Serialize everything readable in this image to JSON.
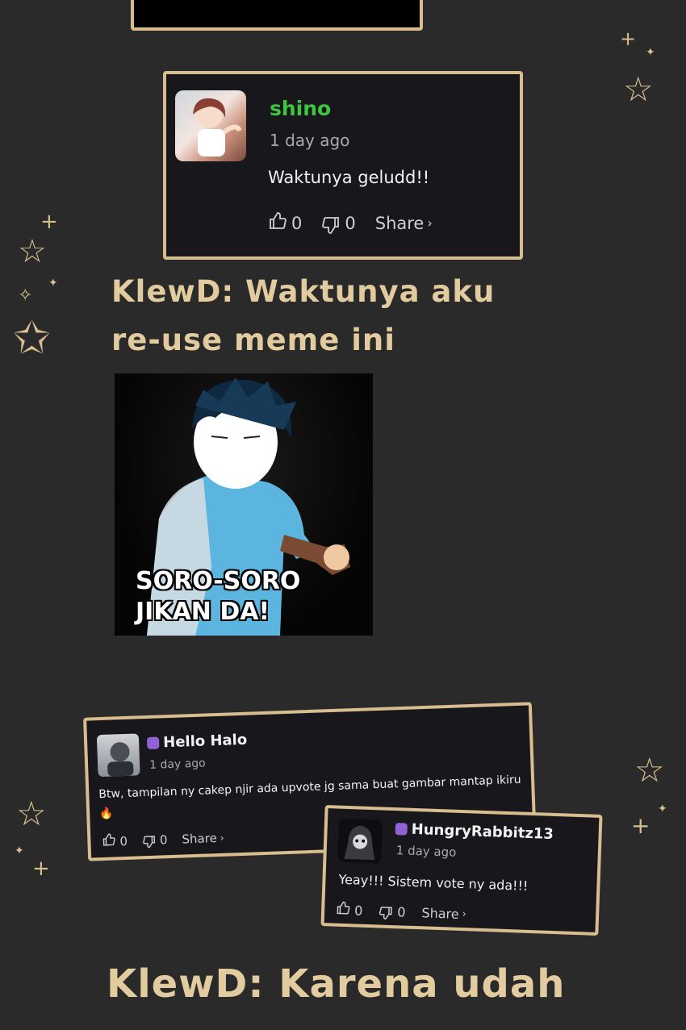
{
  "main_comment": {
    "username": "shino",
    "time": "1 day ago",
    "text": "Waktunya geludd!!",
    "upvotes": "0",
    "downvotes": "0",
    "share_label": "Share"
  },
  "caption_1": {
    "line1": "KlewD: Waktunya aku",
    "line2": "re-use meme ini"
  },
  "meme": {
    "line1": "SORO-SORO",
    "line2": "JIKAN DA!"
  },
  "comment_2": {
    "username": "Hello Halo",
    "time": "1 day ago",
    "text": "Btw, tampilan ny cakep njir ada upvote jg sama buat gambar mantap ikiru",
    "emoji": "🔥",
    "upvotes": "0",
    "downvotes": "0",
    "share_label": "Share"
  },
  "comment_3": {
    "username": "HungryRabbitz13",
    "time": "1 day ago",
    "text": "Yeay!!! Sistem vote ny ada!!!",
    "upvotes": "0",
    "downvotes": "0",
    "share_label": "Share"
  },
  "caption_2": "KlewD: Karena udah",
  "colors": {
    "background": "#2b2a2b",
    "gold": "#d8bd8e",
    "username_green": "#3cc53f",
    "card_bg": "#18171b"
  }
}
